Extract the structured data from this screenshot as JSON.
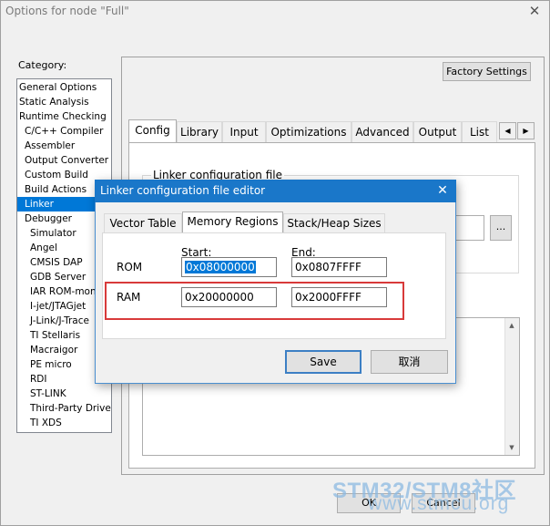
{
  "window": {
    "title": "Options for node \"Full\"",
    "close_glyph": "✕"
  },
  "category": {
    "label": "Category:",
    "items": [
      {
        "label": "General Options",
        "level": 0
      },
      {
        "label": "Static Analysis",
        "level": 0
      },
      {
        "label": "Runtime Checking",
        "level": 0
      },
      {
        "label": "C/C++ Compiler",
        "level": 1
      },
      {
        "label": "Assembler",
        "level": 1
      },
      {
        "label": "Output Converter",
        "level": 1
      },
      {
        "label": "Custom Build",
        "level": 1
      },
      {
        "label": "Build Actions",
        "level": 1
      },
      {
        "label": "Linker",
        "level": 1,
        "selected": true
      },
      {
        "label": "Debugger",
        "level": 1
      },
      {
        "label": "Simulator",
        "level": 2
      },
      {
        "label": "Angel",
        "level": 2
      },
      {
        "label": "CMSIS DAP",
        "level": 2
      },
      {
        "label": "GDB Server",
        "level": 2
      },
      {
        "label": "IAR ROM-moni",
        "level": 2
      },
      {
        "label": "I-jet/JTAGjet",
        "level": 2
      },
      {
        "label": "J-Link/J-Trace",
        "level": 2
      },
      {
        "label": "TI Stellaris",
        "level": 2
      },
      {
        "label": "Macraigor",
        "level": 2
      },
      {
        "label": "PE micro",
        "level": 2
      },
      {
        "label": "RDI",
        "level": 2
      },
      {
        "label": "ST-LINK",
        "level": 2
      },
      {
        "label": "Third-Party Driver",
        "level": 2
      },
      {
        "label": "TI XDS",
        "level": 2
      }
    ]
  },
  "factory_settings_label": "Factory Settings",
  "tabs": [
    "Config",
    "Library",
    "Input",
    "Optimizations",
    "Advanced",
    "Output",
    "List"
  ],
  "tab_arrows": {
    "left": "◀",
    "right": "▶"
  },
  "config": {
    "group_title": "Linker configuration file",
    "browse_label": "..."
  },
  "footer": {
    "ok_label": "OK",
    "cancel_label": "Cancel"
  },
  "dialog": {
    "title": "Linker configuration file editor",
    "close_glyph": "✕",
    "tabs": [
      "Vector Table",
      "Memory Regions",
      "Stack/Heap Sizes"
    ],
    "start_header": "Start:",
    "end_header": "End:",
    "rows": [
      {
        "name": "ROM",
        "start": "0x08000000",
        "end": "0x0807FFFF"
      },
      {
        "name": "RAM",
        "start": "0x20000000",
        "end": "0x2000FFFF"
      }
    ],
    "save_label": "Save",
    "cancel_label": "取消"
  },
  "watermark": {
    "line1": "STM32/STM8社区",
    "line2": "www.stmcu.org"
  },
  "colors": {
    "accent": "#0078d7",
    "dialog_titlebar": "#1a77c9",
    "highlight": "#d83a3a"
  }
}
